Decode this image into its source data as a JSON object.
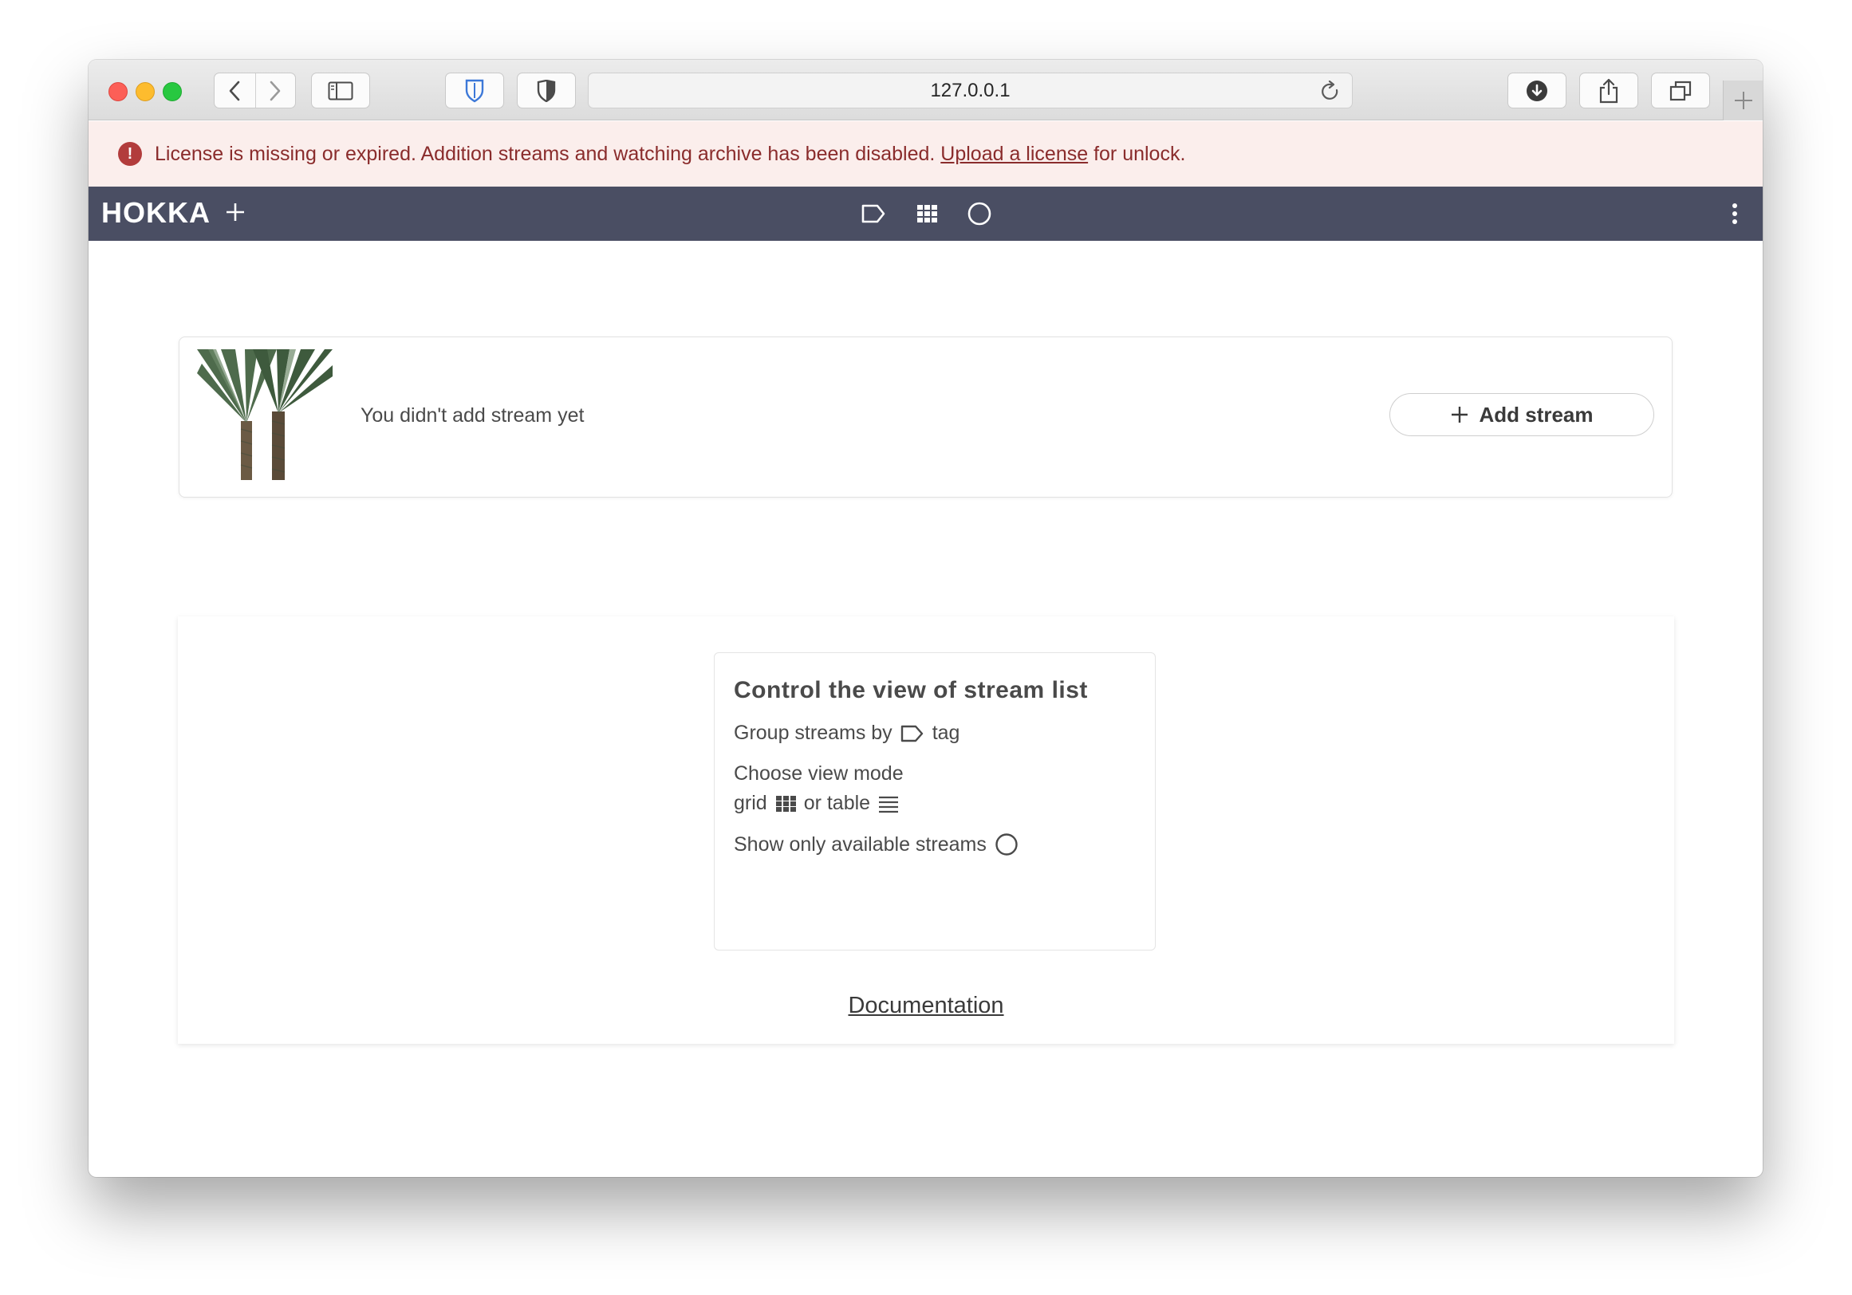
{
  "browser": {
    "url": "127.0.0.1"
  },
  "banner": {
    "message": "License is missing or expired. Addition streams and watching archive has been disabled.",
    "link_label": "Upload a license",
    "suffix": "for unlock.",
    "color": "#8a2c2c",
    "background": "#fbeeec"
  },
  "appbar": {
    "logo": "HOKKA",
    "background": "#4a4e63",
    "icons": [
      "tag-icon",
      "grid-icon",
      "circle-icon"
    ]
  },
  "empty_state": {
    "message": "You didn't add stream yet",
    "add_button_label": "Add stream"
  },
  "help": {
    "title": "Control the view of stream list",
    "group_prefix": "Group streams by",
    "group_suffix": "tag",
    "view_mode_label": "Choose view mode",
    "grid_label": "grid",
    "or_table_label": "or table",
    "available_label": "Show only available streams",
    "documentation_label": "Documentation"
  }
}
